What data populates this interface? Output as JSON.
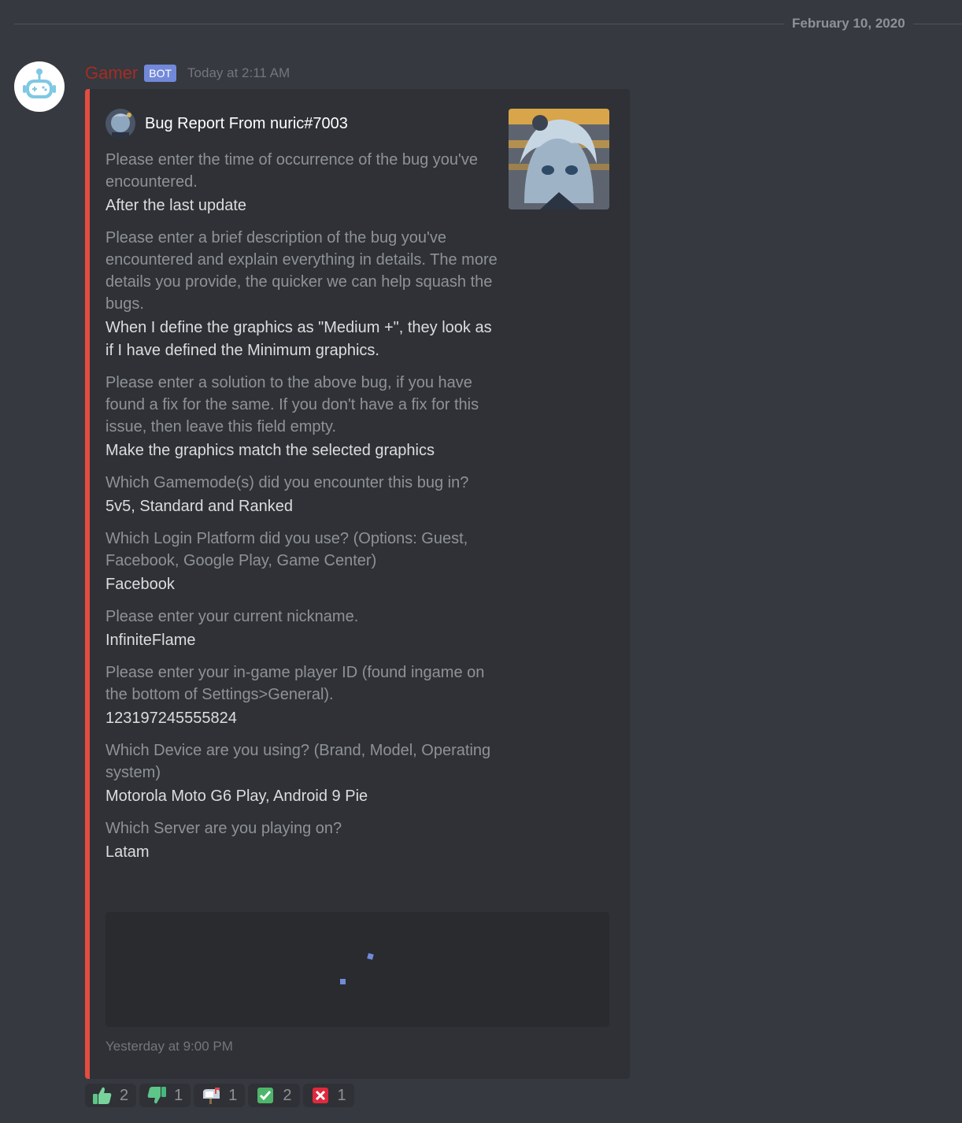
{
  "divider": {
    "date": "February 10, 2020"
  },
  "message": {
    "username": "Gamer",
    "bot_tag": "BOT",
    "timestamp": "Today at 2:11 AM"
  },
  "embed": {
    "color": "#e34c3f",
    "author": "Bug Report From nuric#7003",
    "fields": [
      {
        "name": "Please enter the time of occurrence of the bug you've encountered.",
        "value": "After the last update"
      },
      {
        "name": "Please enter a brief description of the bug you've encountered and explain everything in details. The more details you provide, the quicker we can help squash the bugs.",
        "value": "When I define the graphics as \"Medium +\", they look as if I have defined the Minimum graphics."
      },
      {
        "name": "Please enter a solution to the above bug, if you have found a fix for the same. If you don't have a fix for this issue, then leave this field empty.",
        "value": "Make the graphics match the selected graphics"
      },
      {
        "name": "Which Gamemode(s) did you encounter this bug in?",
        "value": "5v5, Standard and Ranked"
      },
      {
        "name": "Which Login Platform did you use? (Options: Guest, Facebook, Google Play, Game Center)",
        "value": "Facebook"
      },
      {
        "name": "Please enter your current nickname.",
        "value": "InfiniteFlame"
      },
      {
        "name": "Please enter your in-game player ID (found ingame on the bottom of Settings>General).",
        "value": "123197245555824"
      },
      {
        "name": "Which Device are you using? (Brand, Model, Operating system)",
        "value": "Motorola Moto G6 Play, Android 9 Pie"
      },
      {
        "name": "Which Server are you playing on?",
        "value": "Latam"
      }
    ],
    "footer": "Yesterday at 9:00 PM"
  },
  "reactions": [
    {
      "emoji": "thumbs-up-icon",
      "count": "2"
    },
    {
      "emoji": "thumbs-down-icon",
      "count": "1"
    },
    {
      "emoji": "mailbox-icon",
      "count": "1"
    },
    {
      "emoji": "check-mark-icon",
      "count": "2"
    },
    {
      "emoji": "cross-mark-icon",
      "count": "1"
    }
  ],
  "colors": {
    "background": "#36393f",
    "embed_bg": "#2f3136",
    "bot_tag": "#7289da",
    "username": "#a32d25"
  }
}
